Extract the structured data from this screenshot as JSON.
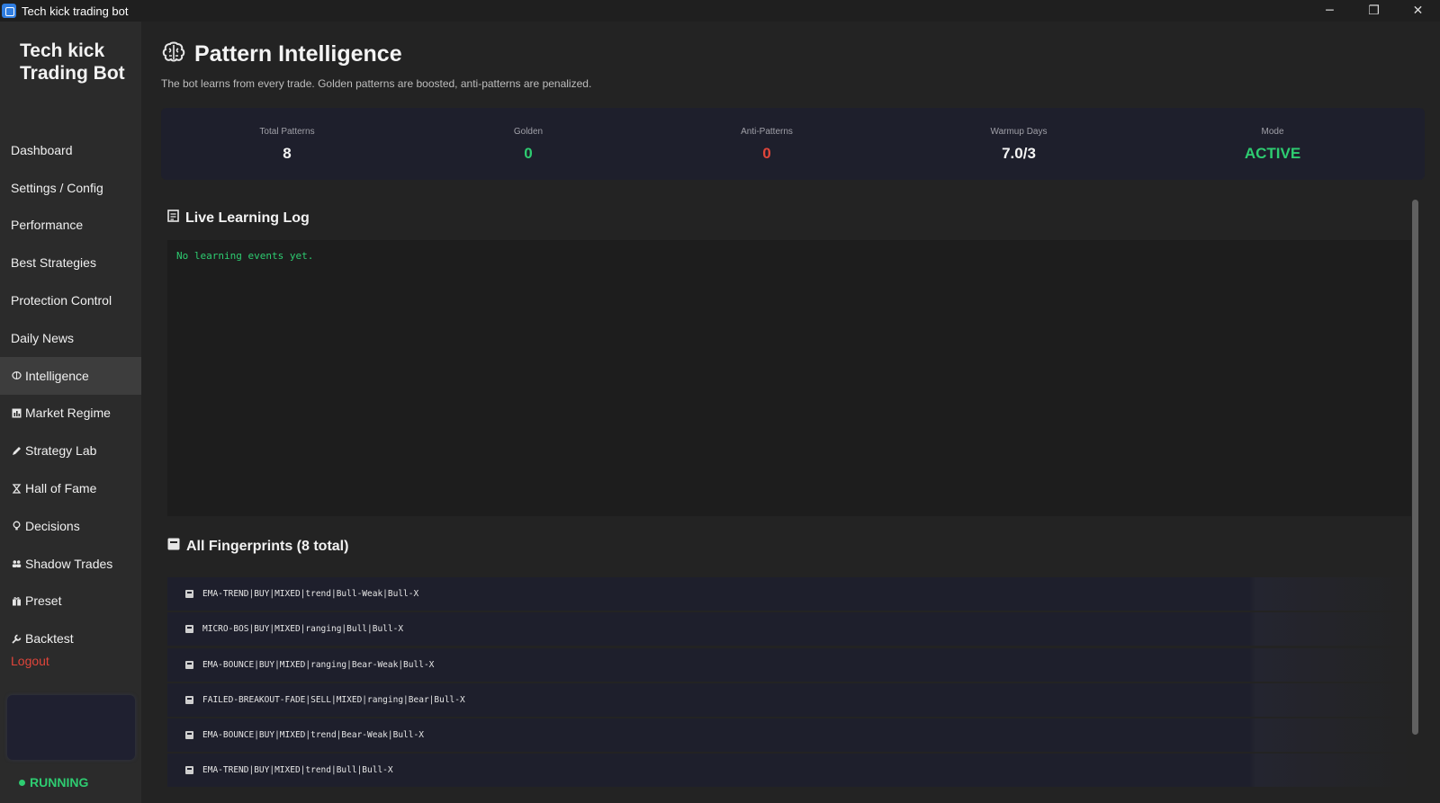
{
  "window": {
    "title": "Tech kick trading bot",
    "controls": {
      "minimize": "─",
      "restore": "❐",
      "close": "✕"
    }
  },
  "sidebar": {
    "brand": "Tech kick Trading Bot",
    "items": [
      {
        "label": "Dashboard",
        "icon": "",
        "active": false
      },
      {
        "label": "Settings / Config",
        "icon": "",
        "active": false
      },
      {
        "label": "Performance",
        "icon": "",
        "active": false
      },
      {
        "label": "Best Strategies",
        "icon": "",
        "active": false
      },
      {
        "label": "Protection Control",
        "icon": "",
        "active": false
      },
      {
        "label": "Daily News",
        "icon": "",
        "active": false
      },
      {
        "label": "Intelligence",
        "icon": "brain-icon",
        "active": true
      },
      {
        "label": "Market Regime",
        "icon": "bar-chart-icon",
        "active": false
      },
      {
        "label": "Strategy Lab",
        "icon": "pencil-icon",
        "active": false
      },
      {
        "label": "Hall of Fame",
        "icon": "hourglass-icon",
        "active": false
      },
      {
        "label": "Decisions",
        "icon": "bulb-icon",
        "active": false
      },
      {
        "label": "Shadow Trades",
        "icon": "users-icon",
        "active": false
      },
      {
        "label": "Preset",
        "icon": "gift-icon",
        "active": false
      },
      {
        "label": "Backtest",
        "icon": "wrench-icon",
        "active": false
      }
    ],
    "logout": "Logout",
    "status": "RUNNING"
  },
  "page": {
    "title": "Pattern Intelligence",
    "subtitle": "The bot learns from every trade. Golden patterns are boosted, anti-patterns are penalized."
  },
  "stats": [
    {
      "label": "Total Patterns",
      "value": "8",
      "color": "#f4f4f4"
    },
    {
      "label": "Golden",
      "value": "0",
      "color": "#2ecc71"
    },
    {
      "label": "Anti-Patterns",
      "value": "0",
      "color": "#e0453a"
    },
    {
      "label": "Warmup Days",
      "value": "7.0/3",
      "color": "#f4f4f4"
    },
    {
      "label": "Mode",
      "value": "ACTIVE",
      "color": "#2ecc71"
    }
  ],
  "learning_log": {
    "title": "Live Learning Log",
    "empty_text": "No learning events yet."
  },
  "fingerprints": {
    "title": "All Fingerprints (8 total)",
    "items": [
      "EMA-TREND|BUY|MIXED|trend|Bull-Weak|Bull-X",
      "MICRO-BOS|BUY|MIXED|ranging|Bull|Bull-X",
      "EMA-BOUNCE|BUY|MIXED|ranging|Bear-Weak|Bull-X",
      "FAILED-BREAKOUT-FADE|SELL|MIXED|ranging|Bear|Bull-X",
      "EMA-BOUNCE|BUY|MIXED|trend|Bear-Weak|Bull-X",
      "EMA-TREND|BUY|MIXED|trend|Bull|Bull-X"
    ]
  }
}
